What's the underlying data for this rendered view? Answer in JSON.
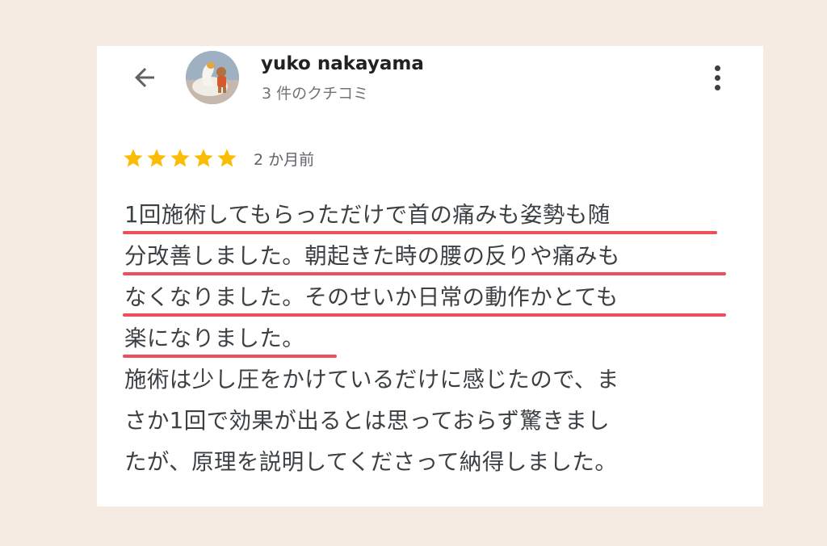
{
  "header": {
    "back_icon": "arrow-back-icon",
    "user_name": "yuko nakayama",
    "review_count": "3 件のクチコミ",
    "more_icon": "more-vertical-icon"
  },
  "review": {
    "rating": 5,
    "rating_max": 5,
    "star_color": "#fbbc04",
    "time": "2 か月前",
    "lines": [
      "1回施術してもらっただけで首の痛みも姿勢も随",
      "分改善しました。朝起きた時の腰の反りや痛みも",
      "なくなりました。そのせいか日常の動作かとても",
      "楽になりました。",
      "施術は少し圧をかけているだけに感じたので、ま",
      "さか1回で効果が出るとは思っておらず驚きまし",
      "たが、原理を説明してくださって納得しました。"
    ],
    "underline_color": "#ee4f5d"
  }
}
